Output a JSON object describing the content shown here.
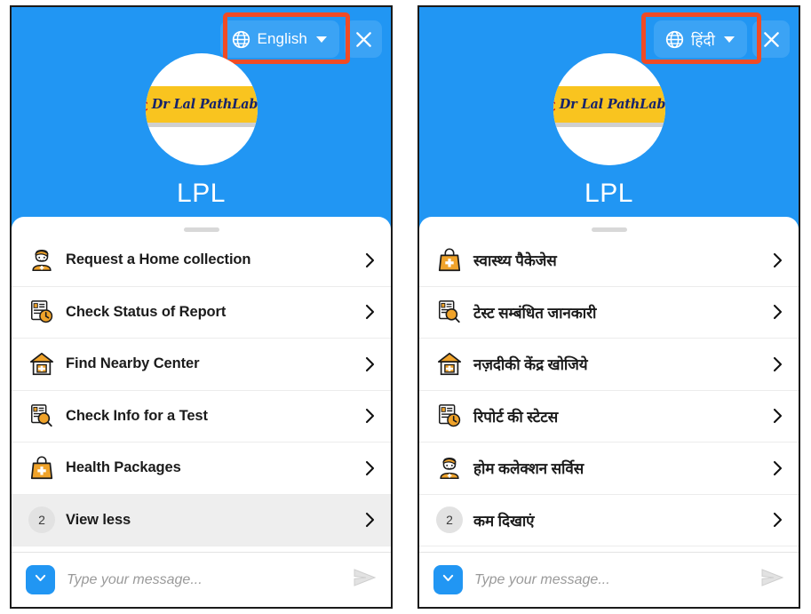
{
  "panels": [
    {
      "id": "english-panel",
      "header": {
        "language_label": "English",
        "globe_icon": "globe-icon",
        "caret_icon": "chevron-down-icon",
        "close_icon": "close-icon",
        "brand": "LPL",
        "logo_text": "Dr Lal PathLabs",
        "logo_mark": "dna-icon"
      },
      "annotation": {
        "color": "#f04b25",
        "target": "language-selector"
      },
      "menu": [
        {
          "label": "Request a Home collection",
          "icon": "home-collection-agent-icon",
          "chevron": "chevron-right-icon",
          "highlight": false
        },
        {
          "label": "Check Status of Report",
          "icon": "report-clock-icon",
          "chevron": "chevron-right-icon",
          "highlight": false
        },
        {
          "label": "Find Nearby Center",
          "icon": "clinic-house-icon",
          "chevron": "chevron-right-icon",
          "highlight": false
        },
        {
          "label": "Check Info for a Test",
          "icon": "document-magnifier-icon",
          "chevron": "chevron-right-icon",
          "highlight": false
        },
        {
          "label": "Health Packages",
          "icon": "health-bag-icon",
          "chevron": "chevron-right-icon",
          "highlight": false
        },
        {
          "label": "View less",
          "badge": "2",
          "icon": "count-badge",
          "chevron": "chevron-right-icon",
          "highlight": true
        }
      ],
      "composer": {
        "quick_icon": "chevron-down-icon",
        "placeholder": "Type your message...",
        "value": "",
        "send_icon": "send-icon"
      }
    },
    {
      "id": "hindi-panel",
      "header": {
        "language_label": "हिंदी",
        "globe_icon": "globe-icon",
        "caret_icon": "chevron-down-icon",
        "close_icon": "close-icon",
        "brand": "LPL",
        "logo_text": "Dr Lal PathLabs",
        "logo_mark": "dna-icon"
      },
      "annotation": {
        "color": "#f04b25",
        "target": "language-selector"
      },
      "menu": [
        {
          "label": "स्वास्थ्य पैकेजेस",
          "icon": "health-bag-icon",
          "chevron": "chevron-right-icon",
          "highlight": false
        },
        {
          "label": "टेस्ट सम्बंधित जानकारी",
          "icon": "document-magnifier-icon",
          "chevron": "chevron-right-icon",
          "highlight": false
        },
        {
          "label": "नज़दीकी केंद्र खोजिये",
          "icon": "clinic-house-icon",
          "chevron": "chevron-right-icon",
          "highlight": false
        },
        {
          "label": "रिपोर्ट की स्टेटस",
          "icon": "report-clock-icon",
          "chevron": "chevron-right-icon",
          "highlight": false
        },
        {
          "label": "होम कलेक्शन सर्विस",
          "icon": "home-collection-agent-icon",
          "chevron": "chevron-right-icon",
          "highlight": false
        },
        {
          "label": "कम दिखाएं",
          "badge": "2",
          "icon": "count-badge",
          "chevron": "chevron-right-icon",
          "highlight": false
        }
      ],
      "composer": {
        "quick_icon": "chevron-down-icon",
        "placeholder": "Type your message...",
        "value": "",
        "send_icon": "send-icon"
      }
    }
  ],
  "colors": {
    "brand_blue": "#2196f3",
    "header_btn_blue": "#3ba3f5",
    "annotation_red": "#f04b25",
    "logo_yellow": "#f9c41f",
    "logo_navy": "#17246b",
    "icon_orange": "#f0a32a",
    "row_highlight": "#eeeeee"
  }
}
